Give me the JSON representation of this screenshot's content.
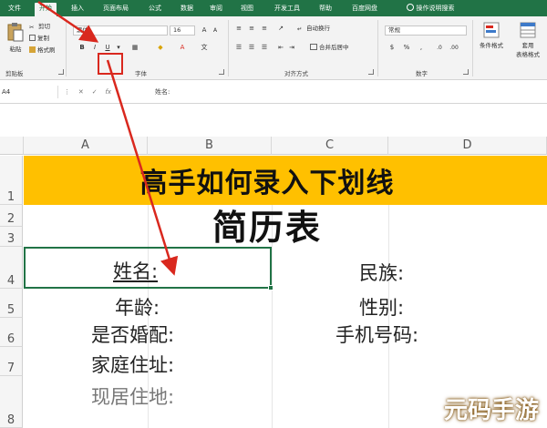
{
  "tabs": [
    {
      "label": "文件",
      "active": false
    },
    {
      "label": "开始",
      "active": true
    },
    {
      "label": "插入",
      "active": false
    },
    {
      "label": "页面布局",
      "active": false
    },
    {
      "label": "公式",
      "active": false
    },
    {
      "label": "数据",
      "active": false
    },
    {
      "label": "审阅",
      "active": false
    },
    {
      "label": "视图",
      "active": false
    },
    {
      "label": "开发工具",
      "active": false
    },
    {
      "label": "帮助",
      "active": false
    },
    {
      "label": "百度网盘",
      "active": false
    },
    {
      "label": "操作说明搜索",
      "active": false
    }
  ],
  "ribbon": {
    "clipboard": {
      "paste_label": "粘贴",
      "cut_label": "剪切",
      "copy_label": "复制",
      "format_painter_label": "格式刷",
      "group_label": "剪贴板"
    },
    "font": {
      "font_name": "黑体",
      "font_size": "16",
      "bold": "B",
      "italic": "I",
      "underline": "U",
      "group_label": "字体"
    },
    "alignment": {
      "wrap_label": "自动换行",
      "merge_label": "合并后居中",
      "group_label": "对齐方式"
    },
    "number": {
      "format": "常规",
      "group_label": "数字"
    },
    "styles": {
      "conditional_label": "条件格式",
      "table_label_line1": "套用",
      "table_label_line2": "表格格式"
    }
  },
  "formula_bar": {
    "name_box": "A4",
    "fx": "fx",
    "content": "姓名:"
  },
  "columns": [
    "A",
    "B",
    "C",
    "D"
  ],
  "rows": [
    "1",
    "2",
    "3",
    "4",
    "5",
    "6",
    "7",
    "8"
  ],
  "sheet": {
    "title": "高手如何录入下划线",
    "subtitle": "简历表",
    "fields_left": [
      "姓名:",
      "年龄:",
      "是否婚配:",
      "家庭住址:",
      "现居住地:"
    ],
    "fields_right": [
      "民族:",
      "性别:",
      "手机号码:"
    ]
  },
  "watermark": "元码手游网",
  "colors": {
    "accent": "#217346",
    "title_band": "#ffc000",
    "annotation": "#d9281e"
  }
}
